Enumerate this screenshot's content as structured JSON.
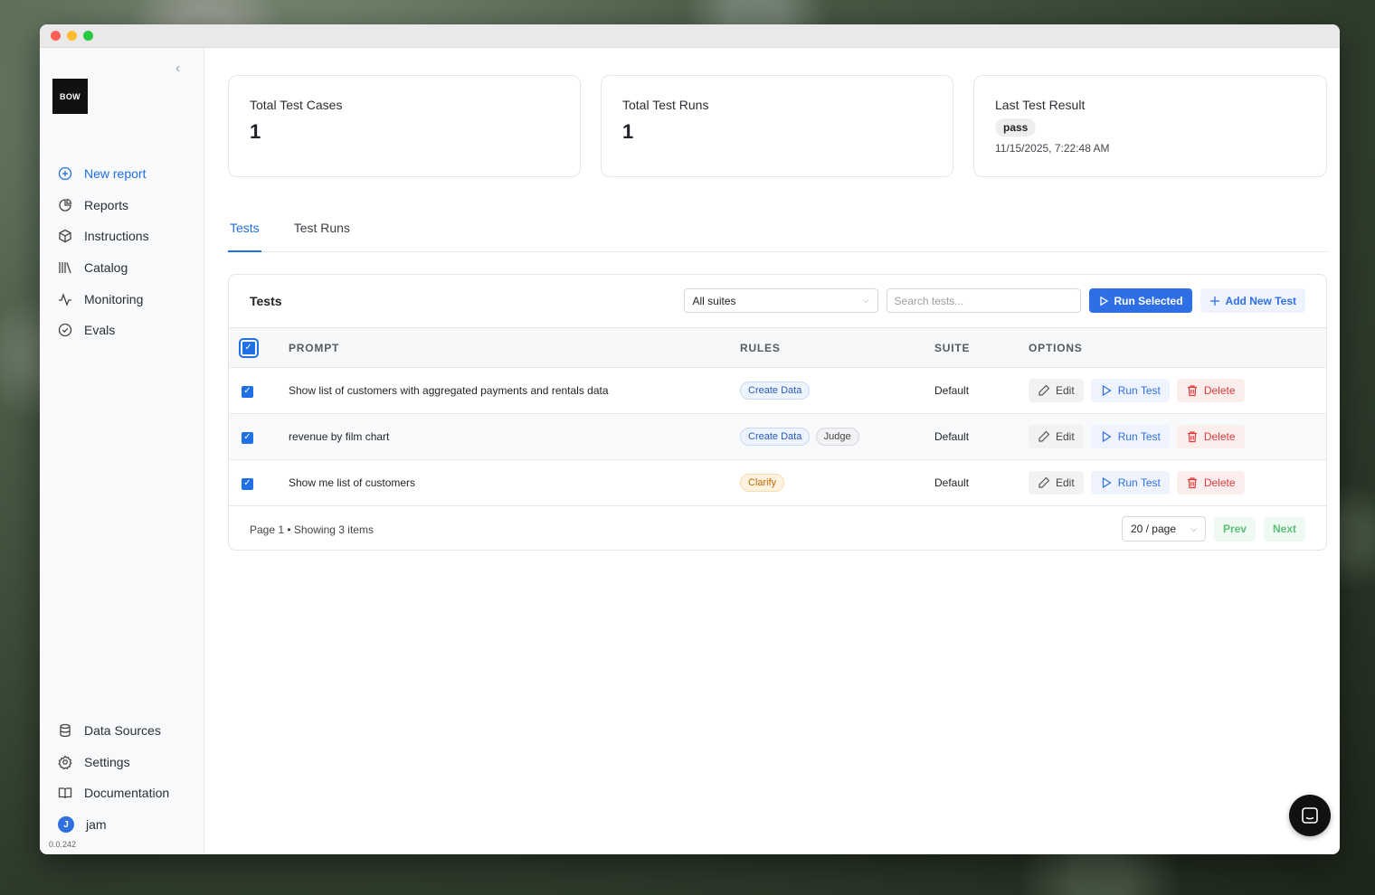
{
  "sidebar": {
    "logo": "BOW",
    "nav_top": [
      {
        "label": "New report",
        "icon": "plus-circle-icon",
        "active": true
      },
      {
        "label": "Reports",
        "icon": "pie-chart-icon"
      },
      {
        "label": "Instructions",
        "icon": "cube-icon"
      },
      {
        "label": "Catalog",
        "icon": "library-icon"
      },
      {
        "label": "Monitoring",
        "icon": "activity-icon"
      },
      {
        "label": "Evals",
        "icon": "check-circle-icon"
      }
    ],
    "nav_bottom": [
      {
        "label": "Data Sources",
        "icon": "database-icon"
      },
      {
        "label": "Settings",
        "icon": "gear-icon"
      },
      {
        "label": "Documentation",
        "icon": "book-icon"
      }
    ],
    "user": {
      "initial": "J",
      "name": "jam"
    },
    "version": "0.0.242"
  },
  "stats": {
    "total_test_cases": {
      "label": "Total Test Cases",
      "value": "1"
    },
    "total_test_runs": {
      "label": "Total Test Runs",
      "value": "1"
    },
    "last_test_result": {
      "label": "Last Test Result",
      "status": "pass",
      "timestamp": "11/15/2025, 7:22:48 AM"
    }
  },
  "tabs": [
    {
      "label": "Tests",
      "active": true
    },
    {
      "label": "Test Runs",
      "active": false
    }
  ],
  "tests_panel": {
    "title": "Tests",
    "suite_select": "All suites",
    "search_placeholder": "Search tests...",
    "run_selected": "Run Selected",
    "add_new_test": "Add New Test",
    "columns": [
      "PROMPT",
      "RULES",
      "SUITE",
      "OPTIONS"
    ],
    "rows": [
      {
        "prompt": "Show list of customers with aggregated payments and rentals data",
        "rules": [
          {
            "label": "Create Data",
            "style": "blue"
          }
        ],
        "suite": "Default",
        "checked": true
      },
      {
        "prompt": "revenue by film chart",
        "rules": [
          {
            "label": "Create Data",
            "style": "blue"
          },
          {
            "label": "Judge",
            "style": "gray"
          }
        ],
        "suite": "Default",
        "checked": true
      },
      {
        "prompt": "Show me list of customers",
        "rules": [
          {
            "label": "Clarify",
            "style": "orange"
          }
        ],
        "suite": "Default",
        "checked": true
      }
    ],
    "row_actions": {
      "edit": "Edit",
      "run": "Run Test",
      "delete": "Delete"
    },
    "footer": {
      "status": "Page 1 • Showing 3 items",
      "page_size": "20 / page",
      "prev": "Prev",
      "next": "Next"
    }
  },
  "colors": {
    "accent": "#2f6fe5",
    "danger": "#e03a3a",
    "success": "#5cc07b"
  }
}
